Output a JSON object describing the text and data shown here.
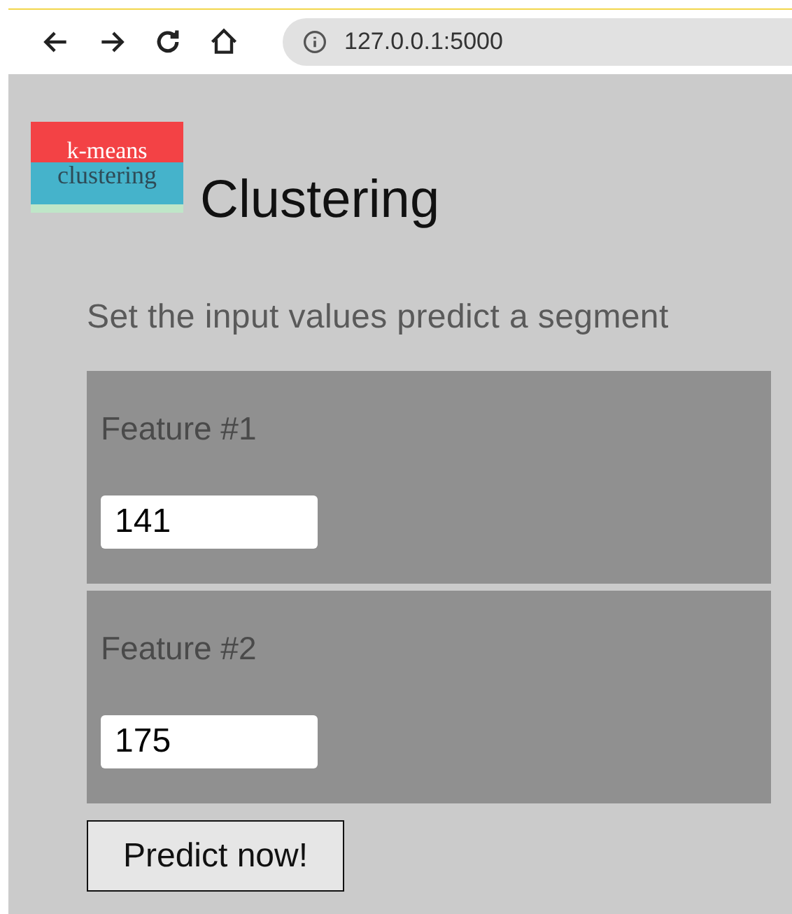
{
  "browser": {
    "url": "127.0.0.1:5000"
  },
  "logo": {
    "line_1": "k-means",
    "line_2": "clustering"
  },
  "title": "Clustering",
  "intro": "Set the input values predict a segment",
  "features": [
    {
      "label": "Feature #1",
      "value": "141"
    },
    {
      "label": "Feature #2",
      "value": "175"
    }
  ],
  "button": "Predict now!"
}
